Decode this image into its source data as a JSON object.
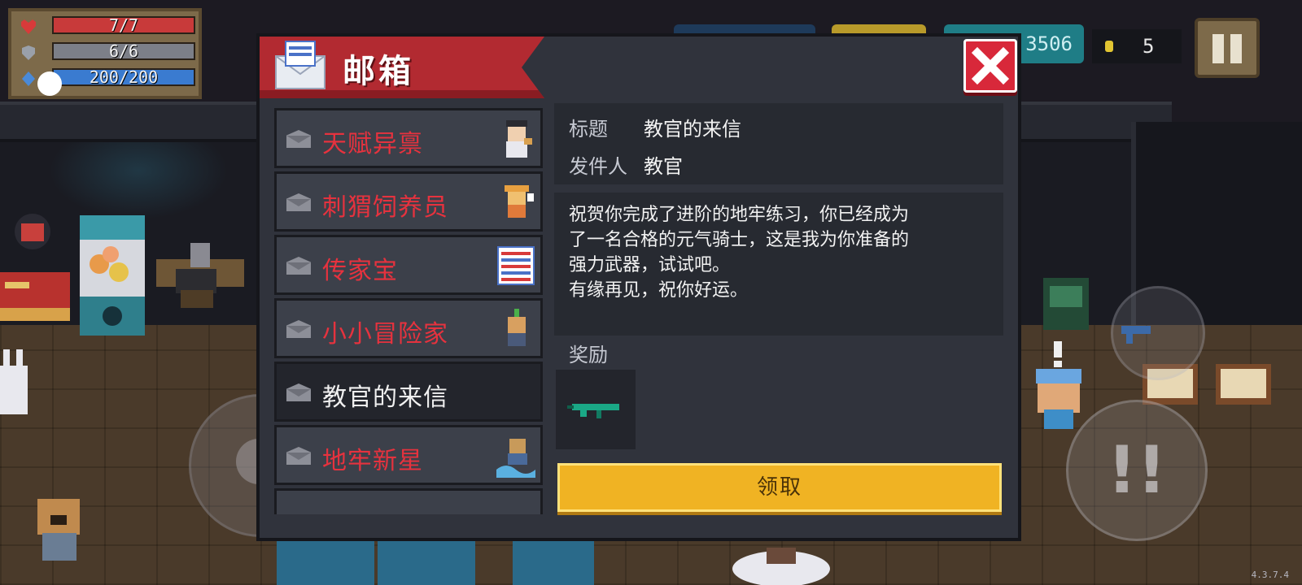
{
  "hud": {
    "hp": "7/7",
    "armor": "6/6",
    "energy": "200/200",
    "hp_fraction": 1.0,
    "armor_fraction": 1.0,
    "energy_fraction": 1.0
  },
  "top_bar": {
    "gems": "3506",
    "coins": "5"
  },
  "mailbox": {
    "title": "邮箱",
    "icon_text": "C.R MAIL",
    "items": [
      {
        "label": "天赋异禀",
        "unread": true
      },
      {
        "label": "刺猬饲养员",
        "unread": true
      },
      {
        "label": "传家宝",
        "unread": true
      },
      {
        "label": "小小冒险家",
        "unread": true
      },
      {
        "label": "教官的来信",
        "unread": false,
        "selected": true
      },
      {
        "label": "地牢新星",
        "unread": true
      }
    ],
    "detail": {
      "subject_key": "标题",
      "subject": "教官的来信",
      "sender_key": "发件人",
      "sender": "教官",
      "body": "祝贺你完成了进阶的地牢练习，你已经成为\n了一名合格的元气骑士，这是我为你准备的\n强力武器，试试吧。\n有缘再见，祝你好运。",
      "reward_label": "奖励",
      "claim_label": "领取"
    }
  },
  "version": "4.3.7.4",
  "colors": {
    "header_red": "#b22a31",
    "unread_text": "#e6323e",
    "claim_button": "#f0b323",
    "close_button": "#d8283a"
  }
}
